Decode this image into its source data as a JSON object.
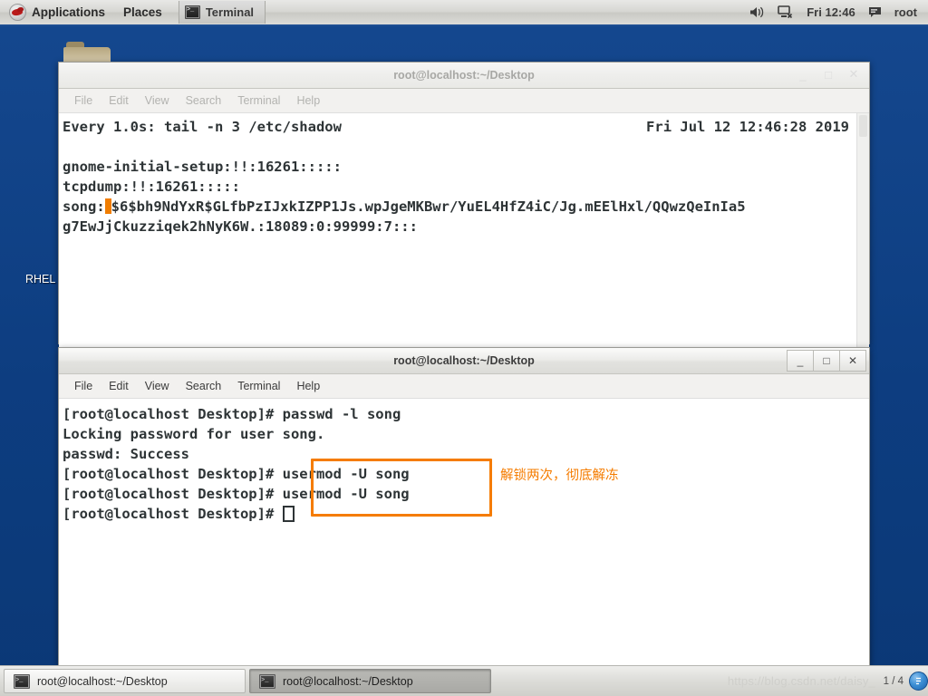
{
  "top_panel": {
    "logo_icon": "redhat-logo-icon",
    "applications_label": "Applications",
    "places_label": "Places",
    "active_window_label": "Terminal",
    "active_window_icon": "terminal-icon",
    "volume_icon": "volume-icon",
    "network_icon": "network-disconnected-icon",
    "clock": "Fri 12:46",
    "user_icon": "message-icon",
    "user_label": "root"
  },
  "desktop": {
    "folder_icon": "folder-icon",
    "label_rhel": "RHEL"
  },
  "window_watch": {
    "title": "root@localhost:~/Desktop",
    "active": false,
    "menu": [
      "File",
      "Edit",
      "View",
      "Search",
      "Terminal",
      "Help"
    ],
    "buttons": {
      "minimize": "_",
      "maximize": "□",
      "close": "✕"
    },
    "lines": [
      "Every 1.0s: tail -n 3 /etc/shadow",
      "",
      "gnome-initial-setup:!!:16261:::::",
      "tcpdump:!!:16261:::::"
    ],
    "header_right": "Fri Jul 12 12:46:28 2019",
    "song_prefix": "song:",
    "song_hash_line1": "$6$bh9NdYxR$GLfbPzIJxkIZPP1Js.wpJgeMKBwr/YuEL4HfZ4iC/Jg.mEElHxl/QQwzQeInIa5",
    "song_hash_line2": "g7EwJjCkuzziqek2hNyK6W.:18089:0:99999:7:::"
  },
  "window_shell": {
    "title": "root@localhost:~/Desktop",
    "active": true,
    "menu": [
      "File",
      "Edit",
      "View",
      "Search",
      "Terminal",
      "Help"
    ],
    "buttons": {
      "minimize": "_",
      "maximize": "□",
      "close": "✕"
    },
    "prompt": "[root@localhost Desktop]# ",
    "lines": [
      {
        "prompt": "[root@localhost Desktop]# ",
        "text": "passwd -l song"
      },
      {
        "prompt": "",
        "text": "Locking password for user song."
      },
      {
        "prompt": "",
        "text": "passwd: Success"
      },
      {
        "prompt": "[root@localhost Desktop]# ",
        "text": "usermod -U song"
      },
      {
        "prompt": "[root@localhost Desktop]# ",
        "text": "usermod -U song"
      }
    ],
    "annotation_text": "解锁两次，彻底解冻",
    "annotation_color": "#f57c00"
  },
  "bottom_panel": {
    "tasks": [
      {
        "label": "root@localhost:~/Desktop",
        "icon": "terminal-icon",
        "active": false
      },
      {
        "label": "root@localhost:~/Desktop",
        "icon": "terminal-icon",
        "active": true
      }
    ],
    "watermark": "https://blog.csdn.net/daisy_",
    "workspace_label": "1 / 4",
    "workspace_icon": "workspace-switcher-icon"
  }
}
